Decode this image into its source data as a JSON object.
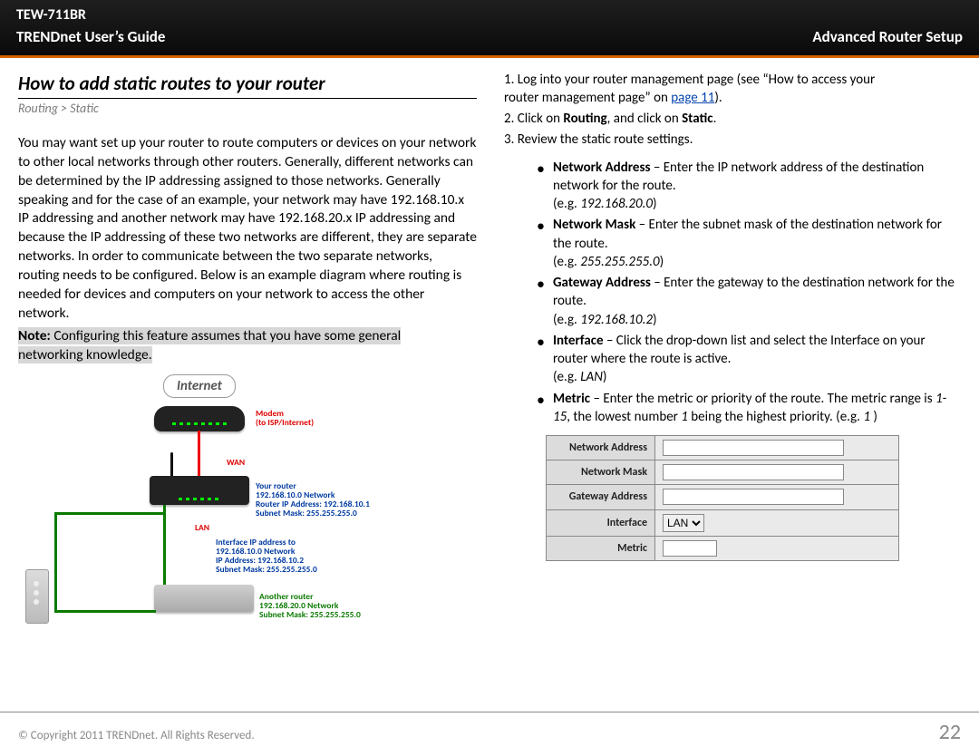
{
  "header": {
    "model": "TEW-711BR",
    "guide": "TRENDnet User’s Guide",
    "section": "Advanced Router Setup"
  },
  "left": {
    "title": "How to add static routes to your router",
    "crumb": "Routing > Static",
    "body": "You may want set up your router to route computers or devices on your network to other local networks through other routers. Generally, different networks can be determined by the IP addressing assigned to those networks. Generally speaking and for the case of an example, your network may have 192.168.10.x IP addressing and another network may have 192.168.20.x IP addressing and because the IP addressing of these two networks are different, they are separate networks. In order to communicate between the two separate networks, routing needs to be configured. Below is an example diagram where routing is needed for devices and computers on your network to access the other network.",
    "note_lead": "Note:",
    "note_rest": " Configuring this feature assumes that you have some general",
    "note_line2": "networking knowledge.",
    "figure": {
      "internet": "Internet",
      "modem1": "Modem",
      "modem2": "(to ISP/Internet)",
      "wan": "WAN",
      "lan": "LAN",
      "your_router": "Your router",
      "yr_net": "192.168.10.0 Network",
      "yr_ip": "Router IP Address: 192.168.10.1",
      "yr_mask": "Subnet Mask: 255.255.255.0",
      "iface1": "Interface IP address to",
      "iface2": "192.168.10.0 Network",
      "iface3": "IP Address: 192.168.10.2",
      "iface4": "Subnet Mask: 255.255.255.0",
      "another": "Another router",
      "an_net": "192.168.20.0 Network",
      "an_mask": "Subnet Mask: 255.255.255.0"
    }
  },
  "right": {
    "step1a": "1. Log into your router management page (see “How to access your",
    "step1b": "router management page” on ",
    "step1_link": "page 11",
    "step1_tail": ").",
    "step2a": "2. Click on ",
    "step2b": "Routing",
    "step2c": ", and click on ",
    "step2d": "Static",
    "step2e": ".",
    "step3": "3. Review the static route settings.",
    "bullets": [
      {
        "term": "Network Address",
        "desc": " – Enter the IP network address of the destination network for the route.",
        "eg_pre": "(e.g. ",
        "eg": "192.168.20.0",
        "eg_post": ")"
      },
      {
        "term": "Network Mask",
        "desc": " – Enter the subnet mask of the destination network for the route.",
        "eg_pre": "(e.g. ",
        "eg": "255.255.255.0",
        "eg_post": ")"
      },
      {
        "term": "Gateway Address",
        "desc": " – Enter the gateway to the destination network for the route.",
        "eg_pre": "(e.g. ",
        "eg": "192.168.10.2",
        "eg_post": ")"
      },
      {
        "term": "Interface",
        "desc": " – Click the drop-down list and select the Interface on your router where the route is active.",
        "eg_pre": "(e.g. ",
        "eg": "LAN",
        "eg_post": ")"
      },
      {
        "term": "Metric",
        "desc": " – Enter the metric or priority of the route. The metric range is ",
        "range": "1-15",
        "desc2": ", the lowest number ",
        "one": "1",
        "desc3": " being the highest priority. (e.g. ",
        "egnum": "1",
        "desc4": " )"
      }
    ],
    "table": {
      "rows": [
        "Network Address",
        "Network Mask",
        "Gateway Address",
        "Interface",
        "Metric"
      ],
      "iface_value": "LAN"
    }
  },
  "footer": {
    "copyright": "© Copyright 2011 TRENDnet. All Rights Reserved.",
    "page": "22"
  }
}
